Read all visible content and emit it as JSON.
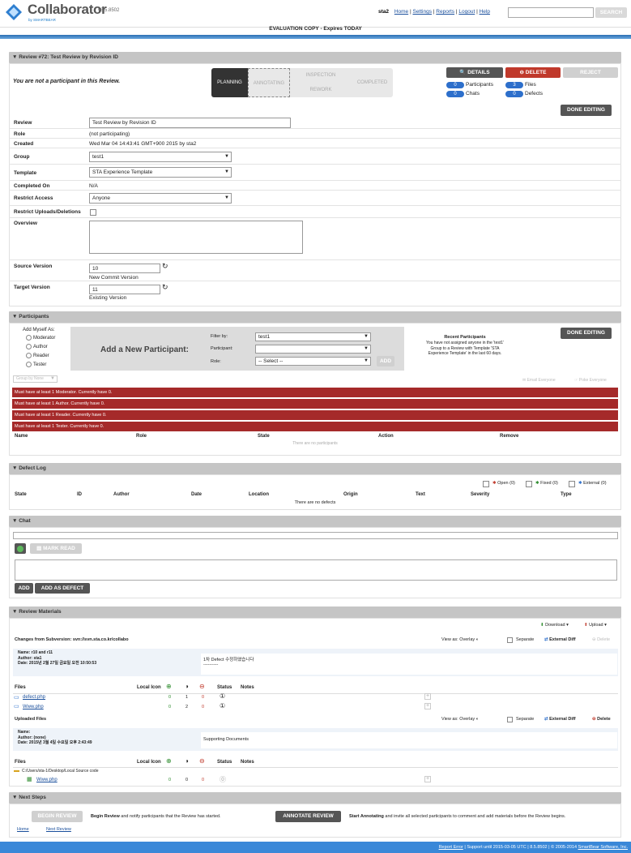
{
  "app": {
    "name": "Collaborator",
    "version": "v8.5.8502",
    "by": "by SMARTBEAR"
  },
  "topnav": {
    "user": "sta2",
    "links": [
      "Home",
      "Settings",
      "Reports",
      "Logout",
      "Help"
    ],
    "search_label": "SEARCH",
    "search_value": ""
  },
  "eval_banner": "EVALUATION COPY - Expires TODAY",
  "review": {
    "title": "▼ Review #72: Test Review by Revision ID",
    "participant_note": "You are not a participant in this Review.",
    "stages": {
      "planning": "PLANNING",
      "annotating": "ANNOTATING",
      "inspection": "INSPECTION",
      "rework": "REWORK",
      "completed": "COMPLETED"
    },
    "buttons": {
      "details": "DETAILS",
      "delete": "DELETE",
      "reject": "REJECT",
      "done_editing": "DONE EDITING"
    },
    "stats": {
      "participants_count": "0",
      "participants_label": "Participants",
      "files_count": "3",
      "files_label": "Files",
      "chats_count": "0",
      "chats_label": "Chats",
      "defects_count": "0",
      "defects_label": "Defects"
    },
    "fields": {
      "review_label": "Review",
      "review_value": "Test Review by Revision ID",
      "role_label": "Role",
      "role_value": "(not participating)",
      "created_label": "Created",
      "created_value": "Wed Mar 04 14:43:41 GMT+900 2015 by sta2",
      "group_label": "Group",
      "group_value": "test1",
      "template_label": "Template",
      "template_value": "STA Experience Template",
      "completed_label": "Completed On",
      "completed_value": "N/A",
      "restrict_label": "Restrict Access",
      "restrict_value": "Anyone",
      "restrict_uploads_label": "Restrict Uploads/Deletions",
      "overview_label": "Overview",
      "source_label": "Source Version",
      "source_value": "10",
      "source_note": "New Commit Version",
      "target_label": "Target Version",
      "target_value": "11",
      "target_note": "Existing Version"
    }
  },
  "participants": {
    "title": "▼ Participants",
    "add_myself": "Add Myself As:",
    "roles": [
      "Moderator",
      "Author",
      "Reader",
      "Tester"
    ],
    "add_new": "Add a New Participant:",
    "filter_label": "Filter by:",
    "filter_value": "test1",
    "participant_label": "Participant:",
    "participant_value": "",
    "role_label": "Role:",
    "role_value": "-- Select --",
    "add_button": "ADD",
    "recent_title": "Recent Participants",
    "recent_text": "You have not assigned anyone in the 'test1' Group to a Review with Template 'STA Experience Template' in the last 60 days.",
    "done_editing": "DONE EDITING",
    "group_by": "Group by None",
    "email_everyone": "Email Everyone",
    "poke_everyone": "Poke Everyone",
    "errors": [
      "Must have at least 1 Moderator. Currently have 0.",
      "Must have at least 1 Author. Currently have 0.",
      "Must have at least 1 Reader. Currently have 0.",
      "Must have at least 1 Tester. Currently have 0."
    ],
    "columns": [
      "Name",
      "Role",
      "State",
      "Action",
      "Remove"
    ],
    "empty": "There are no participants"
  },
  "defects": {
    "title": "▼ Defect Log",
    "open": "Open (0)",
    "fixed": "Fixed (0)",
    "external": "External (0)",
    "columns": [
      "State",
      "ID",
      "Author",
      "Date",
      "Location",
      "Origin",
      "Text",
      "Severity",
      "Type"
    ],
    "empty": "There are no defects"
  },
  "chat": {
    "title": "▼ Chat",
    "mark_read": "MARK READ",
    "add": "ADD",
    "add_as_defect": "ADD AS DEFECT"
  },
  "materials": {
    "title": "▼ Review Materials",
    "download": "Download",
    "upload": "Upload",
    "changes_title": "Changes from Subversion: svn://svn.sta.co.kr/collabo",
    "view_as": "View as: Overlay",
    "separate": "Separate",
    "external_diff": "External Diff",
    "delete": "Delete",
    "rev_name": "Name: r10 and r11",
    "rev_author": "Author: sta1",
    "rev_date": "Date: 2015년 2월 27일 금요일 오전 10:50:53",
    "rev_comment": "1차 Defect 수정하였습니다",
    "rev_comment_line": "----------",
    "files_label": "Files",
    "local_label": "Local Icon",
    "status_label": "Status",
    "notes_label": "Notes",
    "files": [
      {
        "name": "defect.php",
        "a": "0",
        "b": "1",
        "c": "0"
      },
      {
        "name": "Www.php",
        "a": "0",
        "b": "2",
        "c": "0"
      }
    ],
    "uploaded_title": "Uploaded Files",
    "up_name": "Name:",
    "up_author": "Author: (none)",
    "up_date": "Date: 2015년 3월 4일 수요일 오후 2:43:49",
    "up_comment": "Supporting Documents",
    "up_folder": "C:/Users/sta-1/Desktop/Local Source code",
    "up_files": [
      {
        "name": "Www.php",
        "a": "0",
        "b": "0",
        "c": "0"
      }
    ]
  },
  "next_steps": {
    "title": "▼ Next Steps",
    "begin_review": "BEGIN REVIEW",
    "begin_text_b": "Begin Review",
    "begin_text": " and notify participants that the Review has started.",
    "annotate_review": "ANNOTATE REVIEW",
    "annotate_text_b": "Start Annotating",
    "annotate_text": " and invite all selected participants to comment and add materials before the Review begins.",
    "home": "Home",
    "next_review": "Next Review"
  },
  "footer": {
    "report_error": "Report Error",
    "support": "Support until 2015-03-05 UTC",
    "version": "8.5.8502",
    "copyright": "© 2005-2014",
    "company": "SmartBear Software, Inc."
  },
  "colors": {
    "accent": "#2d6fcb",
    "error": "#a52a2a",
    "header": "#c5c5c5"
  }
}
